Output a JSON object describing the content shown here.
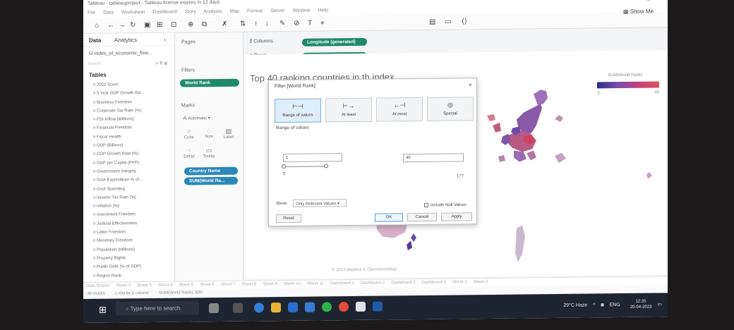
{
  "window": {
    "title": "Tableau - tableauproject - Tableau license expires in 12 days",
    "controls": [
      "–",
      "▢",
      "✕"
    ]
  },
  "menu": [
    "File",
    "Data",
    "Worksheet",
    "Dashboard",
    "Story",
    "Analysis",
    "Map",
    "Format",
    "Server",
    "Window",
    "Help"
  ],
  "toolbar": {
    "show_me": "Show Me"
  },
  "left_panel": {
    "tab_data": "Data",
    "tab_analytics": "Analytics",
    "data_source": "index_of_economic_free...",
    "search_placeholder": "Search",
    "tables_heading": "Tables",
    "fields": [
      "2022 Score",
      "5 Year GDP Growth Ra...",
      "Business Freedom",
      "Corporate Tax Rate (%)",
      "FDI Inflow (Millions)",
      "Financial Freedom",
      "Fiscal Health",
      "GDP (Billions)",
      "GDP Growth Rate (%)",
      "GDP per Capita (PPP)",
      "Government Integrity",
      "Govt Expenditure % of...",
      "Govt Spending",
      "Income Tax Rate (%)",
      "Inflation (%)",
      "Investment Freedom",
      "Judicial Effectiveness",
      "Labor Freedom",
      "Monetary Freedom",
      "Population (Millions)",
      "Property Rights",
      "Public Debt (% of GDP)",
      "Region Rank"
    ]
  },
  "cards": {
    "pages": "Pages",
    "filters": "Filters",
    "filter_pill": "World Rank",
    "marks": "Marks",
    "mark_type": "Automatic",
    "mark_buttons": {
      "color": "Color",
      "size": "Size",
      "label": "Label",
      "detail": "Detail",
      "tooltip": "Tooltip"
    },
    "mark_pills": [
      "Country Name",
      "SUM(World Ra..."
    ]
  },
  "shelves": {
    "columns_label": "Columns",
    "columns_pill": "Longitude (generated)",
    "rows_label": "Rows",
    "rows_pill": "Latitude (generated)"
  },
  "view": {
    "title": "Top 40 ranking countries in th index",
    "legend_title": "SUM(World Rank)",
    "legend_min": "1",
    "legend_max": "40",
    "map_credit": "© 2023 Mapbox © OpenStreetMap",
    "colors": {
      "low": "#2b2b8c",
      "mid": "#7a4fa8",
      "high": "#e0535a"
    }
  },
  "dialog": {
    "title": "Filter [World Rank]",
    "options": [
      "Range of values",
      "At least",
      "At most",
      "Special"
    ],
    "selected_option": "Range of values",
    "section_label": "Range of values",
    "min_value": "1",
    "max_value": "40",
    "range_low": "0",
    "range_high": "177",
    "show_label": "Show:",
    "show_value": "Only Relevant Values",
    "include_null": "Include Null Values",
    "buttons": {
      "reset": "Reset",
      "ok": "OK",
      "cancel": "Cancel",
      "apply": "Apply"
    }
  },
  "sheet_tabs": [
    "Data Source",
    "Sheet 2",
    "Sheet 3",
    "Sheet 4",
    "Sheet 5",
    "Sheet 6",
    "Sheet 7",
    "Sheet 8",
    "Sheet 9",
    "Sheet 10",
    "Sheet 11",
    "Dashboard 1",
    "Dashboard 2",
    "Dashboard 3",
    "Dashboard 4",
    "Sheet 1",
    "Sheet 2"
  ],
  "status_bar": [
    "40 marks",
    "1 row by 1 column",
    "SUM(World Rank): 820"
  ],
  "taskbar": {
    "search_placeholder": "Type here to search",
    "weather": "29°C Haze",
    "language": "ENG",
    "time": "12:35",
    "date": "20-04-2023"
  }
}
